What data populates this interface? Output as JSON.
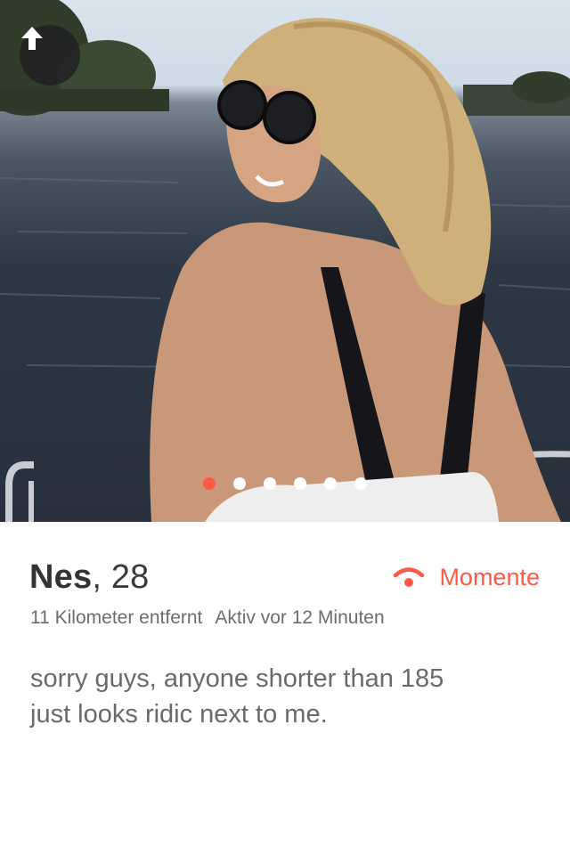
{
  "profile": {
    "name": "Nes",
    "age_text": ", 28",
    "distance": "11 Kilometer entfernt",
    "activity": "Aktiv vor 12 Minuten",
    "bio_line1": "sorry guys, anyone shorter than 185",
    "bio_line2": "just looks ridic next to me."
  },
  "moments": {
    "label": "Momente",
    "icon": "wifi-icon"
  },
  "back_button": {
    "icon": "arrow-up-icon"
  },
  "photo_pager": {
    "count": 6,
    "active_index": 0
  },
  "colors": {
    "accent": "#fd5a46",
    "name_text": "#333333",
    "meta_text": "#6d6d6d",
    "bio_text": "#6a6a6a"
  }
}
